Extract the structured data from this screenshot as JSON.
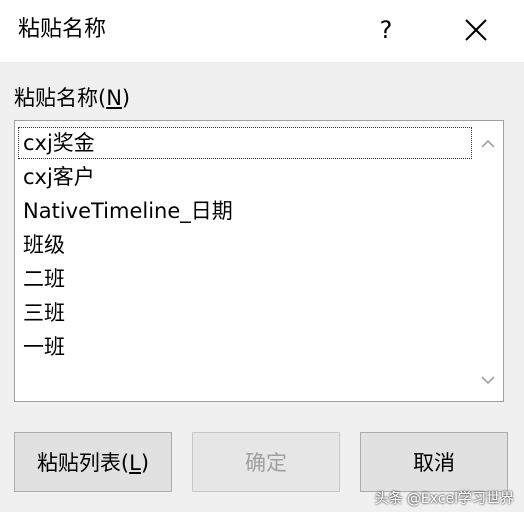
{
  "window": {
    "title": "粘贴名称",
    "help_label": "?"
  },
  "list": {
    "label_prefix": "粘贴名称(",
    "label_mnemonic": "N",
    "label_suffix": ")",
    "items": [
      "cxj奖金",
      "cxj客户",
      "NativeTimeline_日期",
      "班级",
      "二班",
      "三班",
      "一班"
    ],
    "focused_index": 0
  },
  "buttons": {
    "paste_list_prefix": "粘贴列表(",
    "paste_list_mnemonic": "L",
    "paste_list_suffix": ")",
    "ok_label": "确定",
    "ok_enabled": false,
    "cancel_label": "取消"
  },
  "watermark": "头条 @Excel学习世界",
  "colors": {
    "window_bg": "#f0f0f0",
    "titlebar_bg": "#ffffff",
    "list_bg": "#ffffff",
    "button_bg": "#e1e1e1",
    "disabled_text": "#a0a0a0"
  },
  "icons": {
    "close": "close-icon",
    "scroll_up": "chevron-up-icon",
    "scroll_down": "chevron-down-icon"
  }
}
